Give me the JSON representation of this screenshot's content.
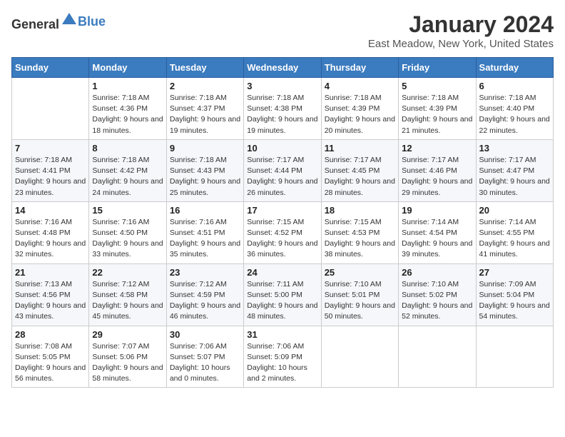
{
  "header": {
    "logo_general": "General",
    "logo_blue": "Blue",
    "month_title": "January 2024",
    "location": "East Meadow, New York, United States"
  },
  "weekdays": [
    "Sunday",
    "Monday",
    "Tuesday",
    "Wednesday",
    "Thursday",
    "Friday",
    "Saturday"
  ],
  "weeks": [
    [
      {
        "day": "",
        "sunrise": "",
        "sunset": "",
        "daylight": ""
      },
      {
        "day": "1",
        "sunrise": "Sunrise: 7:18 AM",
        "sunset": "Sunset: 4:36 PM",
        "daylight": "Daylight: 9 hours and 18 minutes."
      },
      {
        "day": "2",
        "sunrise": "Sunrise: 7:18 AM",
        "sunset": "Sunset: 4:37 PM",
        "daylight": "Daylight: 9 hours and 19 minutes."
      },
      {
        "day": "3",
        "sunrise": "Sunrise: 7:18 AM",
        "sunset": "Sunset: 4:38 PM",
        "daylight": "Daylight: 9 hours and 19 minutes."
      },
      {
        "day": "4",
        "sunrise": "Sunrise: 7:18 AM",
        "sunset": "Sunset: 4:39 PM",
        "daylight": "Daylight: 9 hours and 20 minutes."
      },
      {
        "day": "5",
        "sunrise": "Sunrise: 7:18 AM",
        "sunset": "Sunset: 4:39 PM",
        "daylight": "Daylight: 9 hours and 21 minutes."
      },
      {
        "day": "6",
        "sunrise": "Sunrise: 7:18 AM",
        "sunset": "Sunset: 4:40 PM",
        "daylight": "Daylight: 9 hours and 22 minutes."
      }
    ],
    [
      {
        "day": "7",
        "sunrise": "Sunrise: 7:18 AM",
        "sunset": "Sunset: 4:41 PM",
        "daylight": "Daylight: 9 hours and 23 minutes."
      },
      {
        "day": "8",
        "sunrise": "Sunrise: 7:18 AM",
        "sunset": "Sunset: 4:42 PM",
        "daylight": "Daylight: 9 hours and 24 minutes."
      },
      {
        "day": "9",
        "sunrise": "Sunrise: 7:18 AM",
        "sunset": "Sunset: 4:43 PM",
        "daylight": "Daylight: 9 hours and 25 minutes."
      },
      {
        "day": "10",
        "sunrise": "Sunrise: 7:17 AM",
        "sunset": "Sunset: 4:44 PM",
        "daylight": "Daylight: 9 hours and 26 minutes."
      },
      {
        "day": "11",
        "sunrise": "Sunrise: 7:17 AM",
        "sunset": "Sunset: 4:45 PM",
        "daylight": "Daylight: 9 hours and 28 minutes."
      },
      {
        "day": "12",
        "sunrise": "Sunrise: 7:17 AM",
        "sunset": "Sunset: 4:46 PM",
        "daylight": "Daylight: 9 hours and 29 minutes."
      },
      {
        "day": "13",
        "sunrise": "Sunrise: 7:17 AM",
        "sunset": "Sunset: 4:47 PM",
        "daylight": "Daylight: 9 hours and 30 minutes."
      }
    ],
    [
      {
        "day": "14",
        "sunrise": "Sunrise: 7:16 AM",
        "sunset": "Sunset: 4:48 PM",
        "daylight": "Daylight: 9 hours and 32 minutes."
      },
      {
        "day": "15",
        "sunrise": "Sunrise: 7:16 AM",
        "sunset": "Sunset: 4:50 PM",
        "daylight": "Daylight: 9 hours and 33 minutes."
      },
      {
        "day": "16",
        "sunrise": "Sunrise: 7:16 AM",
        "sunset": "Sunset: 4:51 PM",
        "daylight": "Daylight: 9 hours and 35 minutes."
      },
      {
        "day": "17",
        "sunrise": "Sunrise: 7:15 AM",
        "sunset": "Sunset: 4:52 PM",
        "daylight": "Daylight: 9 hours and 36 minutes."
      },
      {
        "day": "18",
        "sunrise": "Sunrise: 7:15 AM",
        "sunset": "Sunset: 4:53 PM",
        "daylight": "Daylight: 9 hours and 38 minutes."
      },
      {
        "day": "19",
        "sunrise": "Sunrise: 7:14 AM",
        "sunset": "Sunset: 4:54 PM",
        "daylight": "Daylight: 9 hours and 39 minutes."
      },
      {
        "day": "20",
        "sunrise": "Sunrise: 7:14 AM",
        "sunset": "Sunset: 4:55 PM",
        "daylight": "Daylight: 9 hours and 41 minutes."
      }
    ],
    [
      {
        "day": "21",
        "sunrise": "Sunrise: 7:13 AM",
        "sunset": "Sunset: 4:56 PM",
        "daylight": "Daylight: 9 hours and 43 minutes."
      },
      {
        "day": "22",
        "sunrise": "Sunrise: 7:12 AM",
        "sunset": "Sunset: 4:58 PM",
        "daylight": "Daylight: 9 hours and 45 minutes."
      },
      {
        "day": "23",
        "sunrise": "Sunrise: 7:12 AM",
        "sunset": "Sunset: 4:59 PM",
        "daylight": "Daylight: 9 hours and 46 minutes."
      },
      {
        "day": "24",
        "sunrise": "Sunrise: 7:11 AM",
        "sunset": "Sunset: 5:00 PM",
        "daylight": "Daylight: 9 hours and 48 minutes."
      },
      {
        "day": "25",
        "sunrise": "Sunrise: 7:10 AM",
        "sunset": "Sunset: 5:01 PM",
        "daylight": "Daylight: 9 hours and 50 minutes."
      },
      {
        "day": "26",
        "sunrise": "Sunrise: 7:10 AM",
        "sunset": "Sunset: 5:02 PM",
        "daylight": "Daylight: 9 hours and 52 minutes."
      },
      {
        "day": "27",
        "sunrise": "Sunrise: 7:09 AM",
        "sunset": "Sunset: 5:04 PM",
        "daylight": "Daylight: 9 hours and 54 minutes."
      }
    ],
    [
      {
        "day": "28",
        "sunrise": "Sunrise: 7:08 AM",
        "sunset": "Sunset: 5:05 PM",
        "daylight": "Daylight: 9 hours and 56 minutes."
      },
      {
        "day": "29",
        "sunrise": "Sunrise: 7:07 AM",
        "sunset": "Sunset: 5:06 PM",
        "daylight": "Daylight: 9 hours and 58 minutes."
      },
      {
        "day": "30",
        "sunrise": "Sunrise: 7:06 AM",
        "sunset": "Sunset: 5:07 PM",
        "daylight": "Daylight: 10 hours and 0 minutes."
      },
      {
        "day": "31",
        "sunrise": "Sunrise: 7:06 AM",
        "sunset": "Sunset: 5:09 PM",
        "daylight": "Daylight: 10 hours and 2 minutes."
      },
      {
        "day": "",
        "sunrise": "",
        "sunset": "",
        "daylight": ""
      },
      {
        "day": "",
        "sunrise": "",
        "sunset": "",
        "daylight": ""
      },
      {
        "day": "",
        "sunrise": "",
        "sunset": "",
        "daylight": ""
      }
    ]
  ]
}
